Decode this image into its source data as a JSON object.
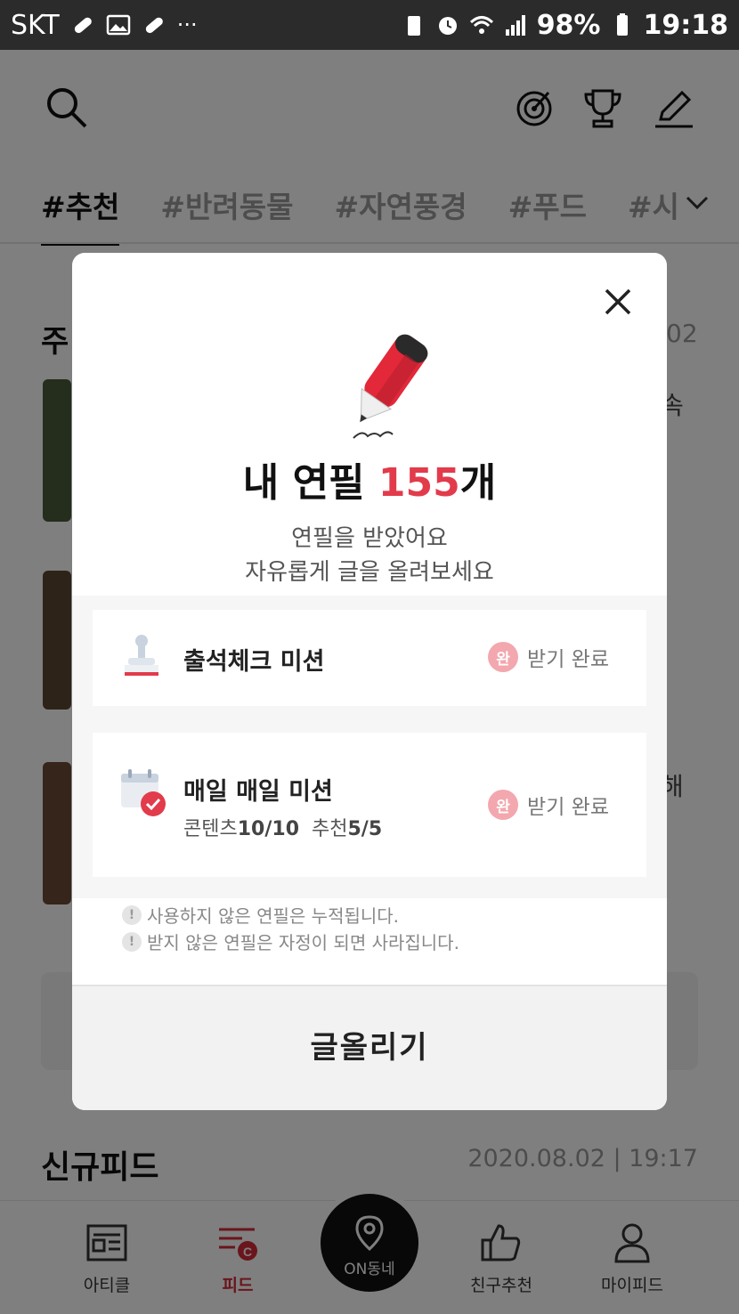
{
  "status_bar": {
    "carrier": "SKT",
    "more": "···",
    "battery": "98%",
    "time": "19:18"
  },
  "header": {
    "icons": [
      "search-icon",
      "target-icon",
      "trophy-icon",
      "pencil-icon"
    ]
  },
  "tabs": [
    "#추천",
    "#반려동물",
    "#자연풍경",
    "#푸드",
    "#시"
  ],
  "background": {
    "section_title_partial": "주",
    "date_partial": "02",
    "side_text_1": "속",
    "side_text_2": "해",
    "new_feed_title": "신규피드",
    "new_feed_date": "2020.08.02 | 19:17"
  },
  "bottom_nav": {
    "items": [
      {
        "label": "아티클",
        "icon": "article-icon"
      },
      {
        "label": "피드",
        "icon": "feed-icon"
      },
      {
        "label": "ON동네",
        "icon": "location-pin-icon"
      },
      {
        "label": "친구추천",
        "icon": "thumbs-up-icon"
      },
      {
        "label": "마이피드",
        "icon": "person-icon"
      }
    ],
    "active": "피드"
  },
  "modal": {
    "title_prefix": "내 연필 ",
    "count": "155",
    "title_suffix": "개",
    "subtitle_line1": "연필을 받았어요",
    "subtitle_line2": "자유롭게 글을 올려보세요",
    "missions": [
      {
        "name": "출석체크 미션",
        "detail": "",
        "badge": "완",
        "status": "받기 완료",
        "icon": "stamp-icon"
      },
      {
        "name": "매일 매일 미션",
        "detail_label_1": "콘텐츠",
        "detail_value_1": "10/10",
        "detail_label_2": "추천",
        "detail_value_2": "5/5",
        "badge": "완",
        "status": "받기 완료",
        "icon": "calendar-check-icon"
      }
    ],
    "notes": [
      "사용하지 않은 연필은 누적됩니다.",
      "받지 않은 연필은 자정이 되면 사라집니다."
    ],
    "note_mark": "!",
    "write_button": "글올리기"
  },
  "colors": {
    "accent": "#e23b4b",
    "badge": "#f3a7ae",
    "overlay": "rgba(0,0,0,0.5)"
  }
}
